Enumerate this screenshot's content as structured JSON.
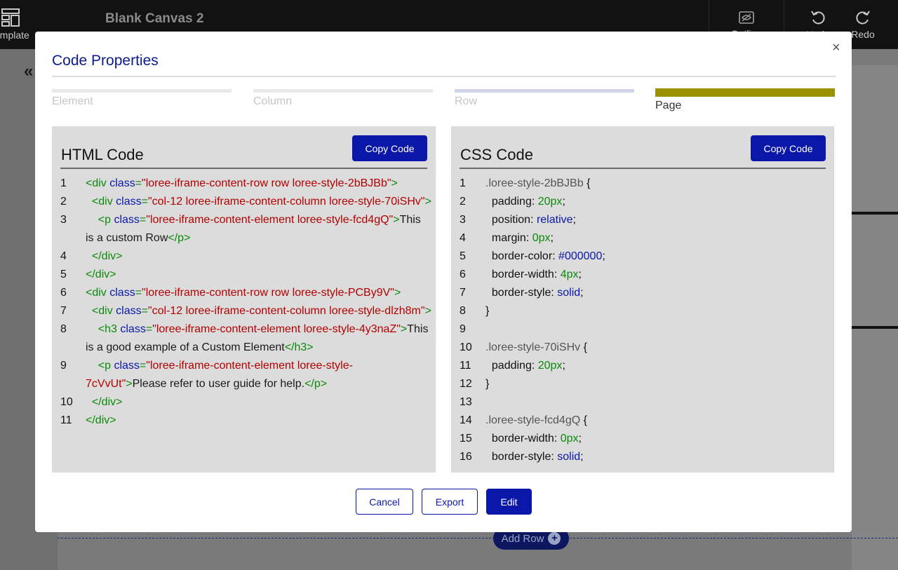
{
  "topbar": {
    "template_label": "emplate",
    "canvas_title": "Blank Canvas 2",
    "outline_label": "Outline",
    "undo_label": "Undo",
    "redo_label": "Redo"
  },
  "background": {
    "collapse_glyph": "«",
    "add_row_label": "Add Row",
    "add_row_plus": "+"
  },
  "modal": {
    "title": "Code Properties",
    "close_glyph": "×",
    "steps": [
      {
        "label": "Element"
      },
      {
        "label": "Column"
      },
      {
        "label": "Row"
      },
      {
        "label": "Page"
      }
    ],
    "html_panel": {
      "title": "HTML Code",
      "copy_label": "Copy Code",
      "lines": [
        {
          "n": "1",
          "tokens": [
            [
              "tg",
              "<div "
            ],
            [
              "at",
              "class"
            ],
            [
              "tg",
              "="
            ],
            [
              "st",
              "\"loree-iframe-content-row row loree-style-2bBJBb\""
            ],
            [
              "tg",
              ">"
            ]
          ]
        },
        {
          "n": "2",
          "tokens": [
            [
              "tg",
              "  <div "
            ],
            [
              "at",
              "class"
            ],
            [
              "tg",
              "="
            ],
            [
              "st",
              "\"col-12 loree-iframe-content-column loree-style-70iSHv\""
            ],
            [
              "tg",
              ">"
            ]
          ]
        },
        {
          "n": "3",
          "tokens": [
            [
              "tg",
              "    <p "
            ],
            [
              "at",
              "class"
            ],
            [
              "tg",
              "="
            ],
            [
              "st",
              "\"loree-iframe-content-element loree-style-fcd4gQ\""
            ],
            [
              "tg",
              ">"
            ],
            [
              "tx",
              "This is a custom Row"
            ],
            [
              "tg",
              "</p>"
            ]
          ]
        },
        {
          "n": "4",
          "tokens": [
            [
              "tg",
              "  </div>"
            ]
          ]
        },
        {
          "n": "5",
          "tokens": [
            [
              "tg",
              "</div>"
            ]
          ]
        },
        {
          "n": "6",
          "tokens": [
            [
              "tg",
              "<div "
            ],
            [
              "at",
              "class"
            ],
            [
              "tg",
              "="
            ],
            [
              "st",
              "\"loree-iframe-content-row row loree-style-PCBy9V\""
            ],
            [
              "tg",
              ">"
            ]
          ]
        },
        {
          "n": "7",
          "tokens": [
            [
              "tg",
              "  <div "
            ],
            [
              "at",
              "class"
            ],
            [
              "tg",
              "="
            ],
            [
              "st",
              "\"col-12 loree-iframe-content-column loree-style-dlzh8m\""
            ],
            [
              "tg",
              ">"
            ]
          ]
        },
        {
          "n": "8",
          "tokens": [
            [
              "tg",
              "    <h3 "
            ],
            [
              "at",
              "class"
            ],
            [
              "tg",
              "="
            ],
            [
              "st",
              "\"loree-iframe-content-element loree-style-4y3naZ\""
            ],
            [
              "tg",
              ">"
            ],
            [
              "tx",
              "This is a good example of a Custom Element"
            ],
            [
              "tg",
              "</h3>"
            ]
          ]
        },
        {
          "n": "9",
          "tokens": [
            [
              "tg",
              "    <p "
            ],
            [
              "at",
              "class"
            ],
            [
              "tg",
              "="
            ],
            [
              "st",
              "\"loree-iframe-content-element loree-style-7cVvUt\""
            ],
            [
              "tg",
              ">"
            ],
            [
              "tx",
              "Please refer to user guide for help."
            ],
            [
              "tg",
              "</p>"
            ]
          ]
        },
        {
          "n": "10",
          "tokens": [
            [
              "tg",
              "  </div>"
            ]
          ]
        },
        {
          "n": "11",
          "tokens": [
            [
              "tg",
              "</div>"
            ]
          ]
        }
      ]
    },
    "css_panel": {
      "title": "CSS Code",
      "copy_label": "Copy Code",
      "lines": [
        {
          "n": "1",
          "tokens": [
            [
              "sel",
              ".loree-style-2bBJBb "
            ],
            [
              "prop",
              "{"
            ]
          ]
        },
        {
          "n": "2",
          "tokens": [
            [
              "prop",
              "  padding: "
            ],
            [
              "num",
              "20px"
            ],
            [
              "prop",
              ";"
            ]
          ]
        },
        {
          "n": "3",
          "tokens": [
            [
              "prop",
              "  position: "
            ],
            [
              "kw",
              "relative"
            ],
            [
              "prop",
              ";"
            ]
          ]
        },
        {
          "n": "4",
          "tokens": [
            [
              "prop",
              "  margin: "
            ],
            [
              "num",
              "0px"
            ],
            [
              "prop",
              ";"
            ]
          ]
        },
        {
          "n": "5",
          "tokens": [
            [
              "prop",
              "  border-color: "
            ],
            [
              "kw",
              "#000000"
            ],
            [
              "prop",
              ";"
            ]
          ]
        },
        {
          "n": "6",
          "tokens": [
            [
              "prop",
              "  border-width: "
            ],
            [
              "num",
              "4px"
            ],
            [
              "prop",
              ";"
            ]
          ]
        },
        {
          "n": "7",
          "tokens": [
            [
              "prop",
              "  border-style: "
            ],
            [
              "kw",
              "solid"
            ],
            [
              "prop",
              ";"
            ]
          ]
        },
        {
          "n": "8",
          "tokens": [
            [
              "prop",
              "}"
            ]
          ]
        },
        {
          "n": "9",
          "tokens": []
        },
        {
          "n": "10",
          "tokens": [
            [
              "sel",
              ".loree-style-70iSHv "
            ],
            [
              "prop",
              "{"
            ]
          ]
        },
        {
          "n": "11",
          "tokens": [
            [
              "prop",
              "  padding: "
            ],
            [
              "num",
              "20px"
            ],
            [
              "prop",
              ";"
            ]
          ]
        },
        {
          "n": "12",
          "tokens": [
            [
              "prop",
              "}"
            ]
          ]
        },
        {
          "n": "13",
          "tokens": []
        },
        {
          "n": "14",
          "tokens": [
            [
              "sel",
              ".loree-style-fcd4gQ "
            ],
            [
              "prop",
              "{"
            ]
          ]
        },
        {
          "n": "15",
          "tokens": [
            [
              "prop",
              "  border-width: "
            ],
            [
              "num",
              "0px"
            ],
            [
              "prop",
              ";"
            ]
          ]
        },
        {
          "n": "16",
          "tokens": [
            [
              "prop",
              "  border-style: "
            ],
            [
              "kw",
              "solid"
            ],
            [
              "prop",
              ";"
            ]
          ]
        }
      ]
    },
    "footer": {
      "cancel_label": "Cancel",
      "export_label": "Export",
      "edit_label": "Edit"
    }
  },
  "colors": {
    "primary": "#0a17a8",
    "title_blue": "#0c1a8f",
    "active_step": "#9a9000",
    "tag_green": "#0a8a0a",
    "string_red": "#b30000"
  }
}
